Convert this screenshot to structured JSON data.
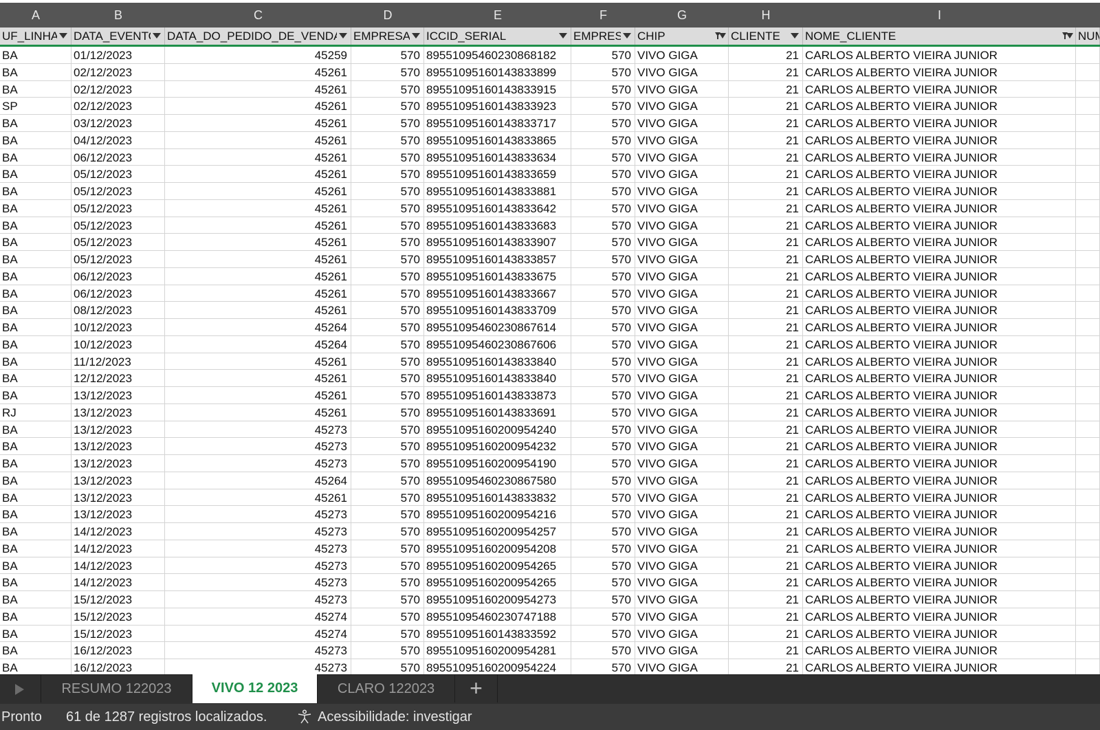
{
  "columns": [
    "A",
    "B",
    "C",
    "D",
    "E",
    "F",
    "G",
    "H",
    "I"
  ],
  "fields": [
    "UF_LINHA",
    "DATA_EVENTO",
    "DATA_DO_PEDIDO_DE_VENDA",
    "EMPRESA",
    "ICCID_SERIAL",
    "EMPRESA",
    "CHIP",
    "CLIENTE",
    "NOME_CLIENTE",
    "NUM"
  ],
  "rows": [
    [
      "BA",
      "01/12/2023",
      "45259",
      "570",
      "89551095460230868182",
      "570",
      "VIVO GIGA",
      "21",
      "CARLOS ALBERTO VIEIRA JUNIOR"
    ],
    [
      "BA",
      "02/12/2023",
      "45261",
      "570",
      "89551095160143833899",
      "570",
      "VIVO GIGA",
      "21",
      "CARLOS ALBERTO VIEIRA JUNIOR"
    ],
    [
      "BA",
      "02/12/2023",
      "45261",
      "570",
      "89551095160143833915",
      "570",
      "VIVO GIGA",
      "21",
      "CARLOS ALBERTO VIEIRA JUNIOR"
    ],
    [
      "SP",
      "02/12/2023",
      "45261",
      "570",
      "89551095160143833923",
      "570",
      "VIVO GIGA",
      "21",
      "CARLOS ALBERTO VIEIRA JUNIOR"
    ],
    [
      "BA",
      "03/12/2023",
      "45261",
      "570",
      "89551095160143833717",
      "570",
      "VIVO GIGA",
      "21",
      "CARLOS ALBERTO VIEIRA JUNIOR"
    ],
    [
      "BA",
      "04/12/2023",
      "45261",
      "570",
      "89551095160143833865",
      "570",
      "VIVO GIGA",
      "21",
      "CARLOS ALBERTO VIEIRA JUNIOR"
    ],
    [
      "BA",
      "06/12/2023",
      "45261",
      "570",
      "89551095160143833634",
      "570",
      "VIVO GIGA",
      "21",
      "CARLOS ALBERTO VIEIRA JUNIOR"
    ],
    [
      "BA",
      "05/12/2023",
      "45261",
      "570",
      "89551095160143833659",
      "570",
      "VIVO GIGA",
      "21",
      "CARLOS ALBERTO VIEIRA JUNIOR"
    ],
    [
      "BA",
      "05/12/2023",
      "45261",
      "570",
      "89551095160143833881",
      "570",
      "VIVO GIGA",
      "21",
      "CARLOS ALBERTO VIEIRA JUNIOR"
    ],
    [
      "BA",
      "05/12/2023",
      "45261",
      "570",
      "89551095160143833642",
      "570",
      "VIVO GIGA",
      "21",
      "CARLOS ALBERTO VIEIRA JUNIOR"
    ],
    [
      "BA",
      "05/12/2023",
      "45261",
      "570",
      "89551095160143833683",
      "570",
      "VIVO GIGA",
      "21",
      "CARLOS ALBERTO VIEIRA JUNIOR"
    ],
    [
      "BA",
      "05/12/2023",
      "45261",
      "570",
      "89551095160143833907",
      "570",
      "VIVO GIGA",
      "21",
      "CARLOS ALBERTO VIEIRA JUNIOR"
    ],
    [
      "BA",
      "05/12/2023",
      "45261",
      "570",
      "89551095160143833857",
      "570",
      "VIVO GIGA",
      "21",
      "CARLOS ALBERTO VIEIRA JUNIOR"
    ],
    [
      "BA",
      "06/12/2023",
      "45261",
      "570",
      "89551095160143833675",
      "570",
      "VIVO GIGA",
      "21",
      "CARLOS ALBERTO VIEIRA JUNIOR"
    ],
    [
      "BA",
      "06/12/2023",
      "45261",
      "570",
      "89551095160143833667",
      "570",
      "VIVO GIGA",
      "21",
      "CARLOS ALBERTO VIEIRA JUNIOR"
    ],
    [
      "BA",
      "08/12/2023",
      "45261",
      "570",
      "89551095160143833709",
      "570",
      "VIVO GIGA",
      "21",
      "CARLOS ALBERTO VIEIRA JUNIOR"
    ],
    [
      "BA",
      "10/12/2023",
      "45264",
      "570",
      "89551095460230867614",
      "570",
      "VIVO GIGA",
      "21",
      "CARLOS ALBERTO VIEIRA JUNIOR"
    ],
    [
      "BA",
      "10/12/2023",
      "45264",
      "570",
      "89551095460230867606",
      "570",
      "VIVO GIGA",
      "21",
      "CARLOS ALBERTO VIEIRA JUNIOR"
    ],
    [
      "BA",
      "11/12/2023",
      "45261",
      "570",
      "89551095160143833840",
      "570",
      "VIVO GIGA",
      "21",
      "CARLOS ALBERTO VIEIRA JUNIOR"
    ],
    [
      "BA",
      "12/12/2023",
      "45261",
      "570",
      "89551095160143833840",
      "570",
      "VIVO GIGA",
      "21",
      "CARLOS ALBERTO VIEIRA JUNIOR"
    ],
    [
      "BA",
      "13/12/2023",
      "45261",
      "570",
      "89551095160143833873",
      "570",
      "VIVO GIGA",
      "21",
      "CARLOS ALBERTO VIEIRA JUNIOR"
    ],
    [
      "RJ",
      "13/12/2023",
      "45261",
      "570",
      "89551095160143833691",
      "570",
      "VIVO GIGA",
      "21",
      "CARLOS ALBERTO VIEIRA JUNIOR"
    ],
    [
      "BA",
      "13/12/2023",
      "45273",
      "570",
      "89551095160200954240",
      "570",
      "VIVO GIGA",
      "21",
      "CARLOS ALBERTO VIEIRA JUNIOR"
    ],
    [
      "BA",
      "13/12/2023",
      "45273",
      "570",
      "89551095160200954232",
      "570",
      "VIVO GIGA",
      "21",
      "CARLOS ALBERTO VIEIRA JUNIOR"
    ],
    [
      "BA",
      "13/12/2023",
      "45273",
      "570",
      "89551095160200954190",
      "570",
      "VIVO GIGA",
      "21",
      "CARLOS ALBERTO VIEIRA JUNIOR"
    ],
    [
      "BA",
      "13/12/2023",
      "45264",
      "570",
      "89551095460230867580",
      "570",
      "VIVO GIGA",
      "21",
      "CARLOS ALBERTO VIEIRA JUNIOR"
    ],
    [
      "BA",
      "13/12/2023",
      "45261",
      "570",
      "89551095160143833832",
      "570",
      "VIVO GIGA",
      "21",
      "CARLOS ALBERTO VIEIRA JUNIOR"
    ],
    [
      "BA",
      "13/12/2023",
      "45273",
      "570",
      "89551095160200954216",
      "570",
      "VIVO GIGA",
      "21",
      "CARLOS ALBERTO VIEIRA JUNIOR"
    ],
    [
      "BA",
      "14/12/2023",
      "45273",
      "570",
      "89551095160200954257",
      "570",
      "VIVO GIGA",
      "21",
      "CARLOS ALBERTO VIEIRA JUNIOR"
    ],
    [
      "BA",
      "14/12/2023",
      "45273",
      "570",
      "89551095160200954208",
      "570",
      "VIVO GIGA",
      "21",
      "CARLOS ALBERTO VIEIRA JUNIOR"
    ],
    [
      "BA",
      "14/12/2023",
      "45273",
      "570",
      "89551095160200954265",
      "570",
      "VIVO GIGA",
      "21",
      "CARLOS ALBERTO VIEIRA JUNIOR"
    ],
    [
      "BA",
      "14/12/2023",
      "45273",
      "570",
      "89551095160200954265",
      "570",
      "VIVO GIGA",
      "21",
      "CARLOS ALBERTO VIEIRA JUNIOR"
    ],
    [
      "BA",
      "15/12/2023",
      "45273",
      "570",
      "89551095160200954273",
      "570",
      "VIVO GIGA",
      "21",
      "CARLOS ALBERTO VIEIRA JUNIOR"
    ],
    [
      "BA",
      "15/12/2023",
      "45274",
      "570",
      "89551095460230747188",
      "570",
      "VIVO GIGA",
      "21",
      "CARLOS ALBERTO VIEIRA JUNIOR"
    ],
    [
      "BA",
      "15/12/2023",
      "45274",
      "570",
      "89551095160143833592",
      "570",
      "VIVO GIGA",
      "21",
      "CARLOS ALBERTO VIEIRA JUNIOR"
    ],
    [
      "BA",
      "16/12/2023",
      "45273",
      "570",
      "89551095160200954281",
      "570",
      "VIVO GIGA",
      "21",
      "CARLOS ALBERTO VIEIRA JUNIOR"
    ],
    [
      "BA",
      "16/12/2023",
      "45273",
      "570",
      "89551095160200954224",
      "570",
      "VIVO GIGA",
      "21",
      "CARLOS ALBERTO VIEIRA JUNIOR"
    ]
  ],
  "tabs": [
    "RESUMO 122023",
    "VIVO 12 2023",
    "CLARO 122023"
  ],
  "active_tab": "VIVO 12 2023",
  "add_sheet_label": "+",
  "status": {
    "mode": "Pronto",
    "records": "61 de 1287 registros localizados.",
    "accessibility": "Acessibilidade: investigar"
  },
  "colors": {
    "accent": "#1f8f4a",
    "header_bg": "#555555",
    "tabbar_bg": "#2f2f2f",
    "statusbar_bg": "#3b3b3b"
  }
}
